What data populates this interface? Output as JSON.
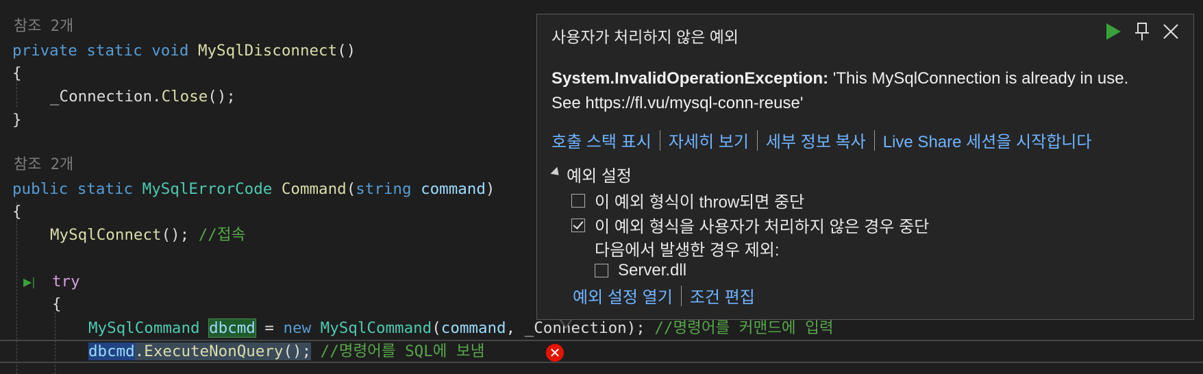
{
  "code": {
    "ref1": "참조 2개",
    "l_private": "private",
    "l_static": "static",
    "l_void": "void",
    "fn_disconnect": "MySqlDisconnect",
    "parens": "()",
    "open_brace": "{",
    "close_brace": "}",
    "conn_field": "_Connection",
    "close_call": "Close",
    "call_end": "();",
    "ref2": "참조 2개",
    "l_public": "public",
    "ret_type": "MySqlErrorCode",
    "fn_command": "Command",
    "param_type": "string",
    "param_name": "command",
    "fn_connect": "MySqlConnect",
    "comment_connect": "//접속",
    "l_try": "try",
    "t_mysqlcommand": "MySqlCommand",
    "var_dbcmd": "dbcmd",
    "assign": " = ",
    "l_new": "new",
    "ctor_mysqlcommand": "MySqlCommand",
    "arg_command": "command",
    "arg_connection": "_Connection",
    "comment_input": "//명령어를 커맨드에 입력",
    "var_dbcmd2": "dbcmd",
    "exec_call": "ExecuteNonQuery",
    "comment_send": "//명령어를 SQL에 보냄"
  },
  "popup": {
    "title": "사용자가 처리하지 않은 예외",
    "exception_type": "System.InvalidOperationException:",
    "exception_message": "'This MySqlConnection is already in use. See https://fl.vu/mysql-conn-reuse'",
    "links": [
      "호출 스택 표시",
      "자세히 보기",
      "세부 정보 복사",
      "Live Share 세션을 시작합니다"
    ],
    "settings_header": "예외 설정",
    "options": [
      {
        "label": "이 예외 형식이 throw되면 중단",
        "checked": false
      },
      {
        "label": "이 예외 형식을 사용자가 처리하지 않은 경우 중단",
        "checked": true
      }
    ],
    "except_label": "다음에서 발생한 경우 제외:",
    "module_option": {
      "label": "Server.dll",
      "checked": false
    },
    "bottom_links": [
      "예외 설정 열기",
      "조건 편집"
    ]
  },
  "colors": {
    "background": "#1e1e1e",
    "keyword": "#569cd6",
    "type": "#4ec9b0",
    "function": "#dcdcaa",
    "comment": "#57a64a",
    "link": "#6fb4ff",
    "error": "#e51400"
  }
}
